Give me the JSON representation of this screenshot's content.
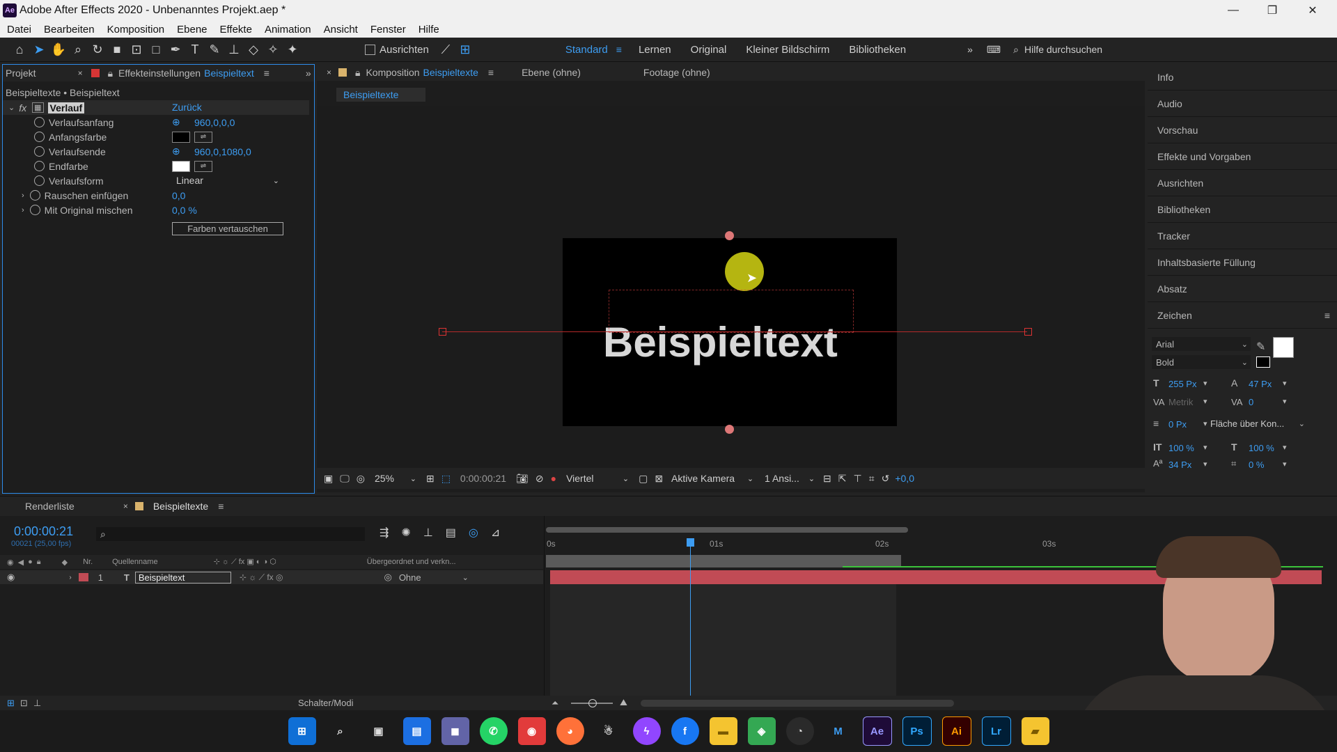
{
  "window": {
    "title": "Adobe After Effects 2020 - Unbenanntes Projekt.aep *",
    "logo": "Ae"
  },
  "menu": [
    "Datei",
    "Bearbeiten",
    "Komposition",
    "Ebene",
    "Effekte",
    "Animation",
    "Ansicht",
    "Fenster",
    "Hilfe"
  ],
  "toolbar": {
    "align_label": "Ausrichten",
    "search_placeholder": "Hilfe durchsuchen",
    "workspaces": [
      "Standard",
      "Lernen",
      "Original",
      "Kleiner Bildschirm",
      "Bibliotheken"
    ]
  },
  "left_panel": {
    "tab_project": "Projekt",
    "tab_effects": "Effekteinstellungen",
    "tab_effects_layer": "Beispieltext",
    "breadcrumb": "Beispieltexte • Beispieltext",
    "effect_name": "Verlauf",
    "reset": "Zurück",
    "props": [
      {
        "name": "Verlaufsanfang",
        "value": "960,0,0,0"
      },
      {
        "name": "Anfangsfarbe",
        "value": ""
      },
      {
        "name": "Verlaufsende",
        "value": "960,0,1080,0"
      },
      {
        "name": "Endfarbe",
        "value": ""
      },
      {
        "name": "Verlaufsform",
        "value": "Linear"
      },
      {
        "name": "Rauschen einfügen",
        "value": "0,0"
      },
      {
        "name": "Mit Original mischen",
        "value": "0,0 %"
      }
    ],
    "swap_button": "Farben vertauschen"
  },
  "comp_panel": {
    "tab_label": "Komposition",
    "tab_name": "Beispieltexte",
    "tab_layer": "Ebene (ohne)",
    "tab_footage": "Footage (ohne)",
    "subtab": "Beispieltexte",
    "canvas_text": "Beispieltext",
    "footer": {
      "zoom": "25%",
      "timecode": "0:00:00:21",
      "resolution": "Viertel",
      "camera": "Aktive Kamera",
      "views": "1 Ansi...",
      "exposure": "+0,0"
    }
  },
  "right_panel": {
    "items": [
      "Info",
      "Audio",
      "Vorschau",
      "Effekte und Vorgaben",
      "Ausrichten",
      "Bibliotheken",
      "Tracker",
      "Inhaltsbasierte Füllung",
      "Absatz"
    ],
    "char_title": "Zeichen",
    "font": "Arial",
    "style": "Bold",
    "size": "255 Px",
    "leading": "47 Px",
    "kerning": "Metrik",
    "tracking": "0",
    "stroke": "0 Px",
    "stroke_mode": "Fläche über Kon...",
    "vscale": "100 %",
    "hscale": "100 %",
    "baseline": "34 Px",
    "tsume": "0 %"
  },
  "timeline": {
    "tab_render": "Renderliste",
    "tab_comp": "Beispieltexte",
    "timecode": "0:00:00:21",
    "fps": "00021 (25,00 fps)",
    "col_nr": "Nr.",
    "col_source": "Quellenname",
    "col_parent": "Übergeordnet und verkn...",
    "layer": {
      "nr": "1",
      "type": "T",
      "name": "Beispieltext",
      "parent": "Ohne"
    },
    "ruler": [
      "0s",
      "01s",
      "02s",
      "03s"
    ],
    "footer": "Schalter/Modi"
  },
  "taskbar": [
    "Start",
    "Suche",
    "Aufgaben",
    "Widgets",
    "Teams",
    "WhatsApp",
    "Rec",
    "Firefox",
    "App",
    "Messenger",
    "Facebook",
    "Explorer",
    "Karten",
    "OBS",
    "App2",
    "Ae",
    "Ps",
    "Ai",
    "Lr",
    "Ordner"
  ],
  "colors": {
    "accent": "#3d9df2",
    "layer_bar": "#c14b55",
    "ae": "#9999ff",
    "ps": "#31a8ff",
    "ai": "#ff9a00",
    "lr": "#31a8ff"
  }
}
